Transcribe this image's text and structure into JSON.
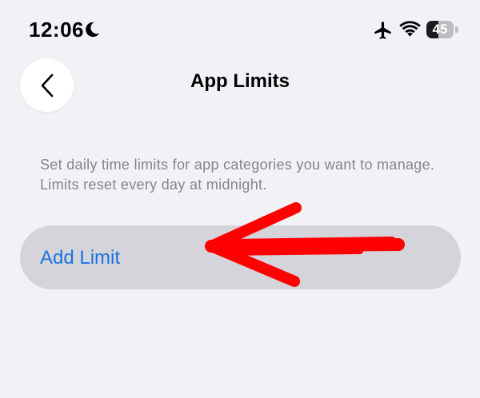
{
  "status_bar": {
    "time": "12:06",
    "battery_level": "45",
    "icons": [
      "moon-icon",
      "airplane-icon",
      "wifi-icon",
      "battery-icon"
    ]
  },
  "nav": {
    "back_icon": "chevron-left-icon",
    "title": "App Limits"
  },
  "description": "Set daily time limits for app categories you want to manage. Limits reset every day at midnight.",
  "add_limit": {
    "label": "Add Limit"
  },
  "annotation": {
    "icon": "red-arrow-annotation",
    "color": "#ff0000"
  },
  "colors": {
    "background": "#f2f1f6",
    "accent": "#1a73e0",
    "button_bg": "#d4d4da",
    "secondary_text": "#848489"
  }
}
